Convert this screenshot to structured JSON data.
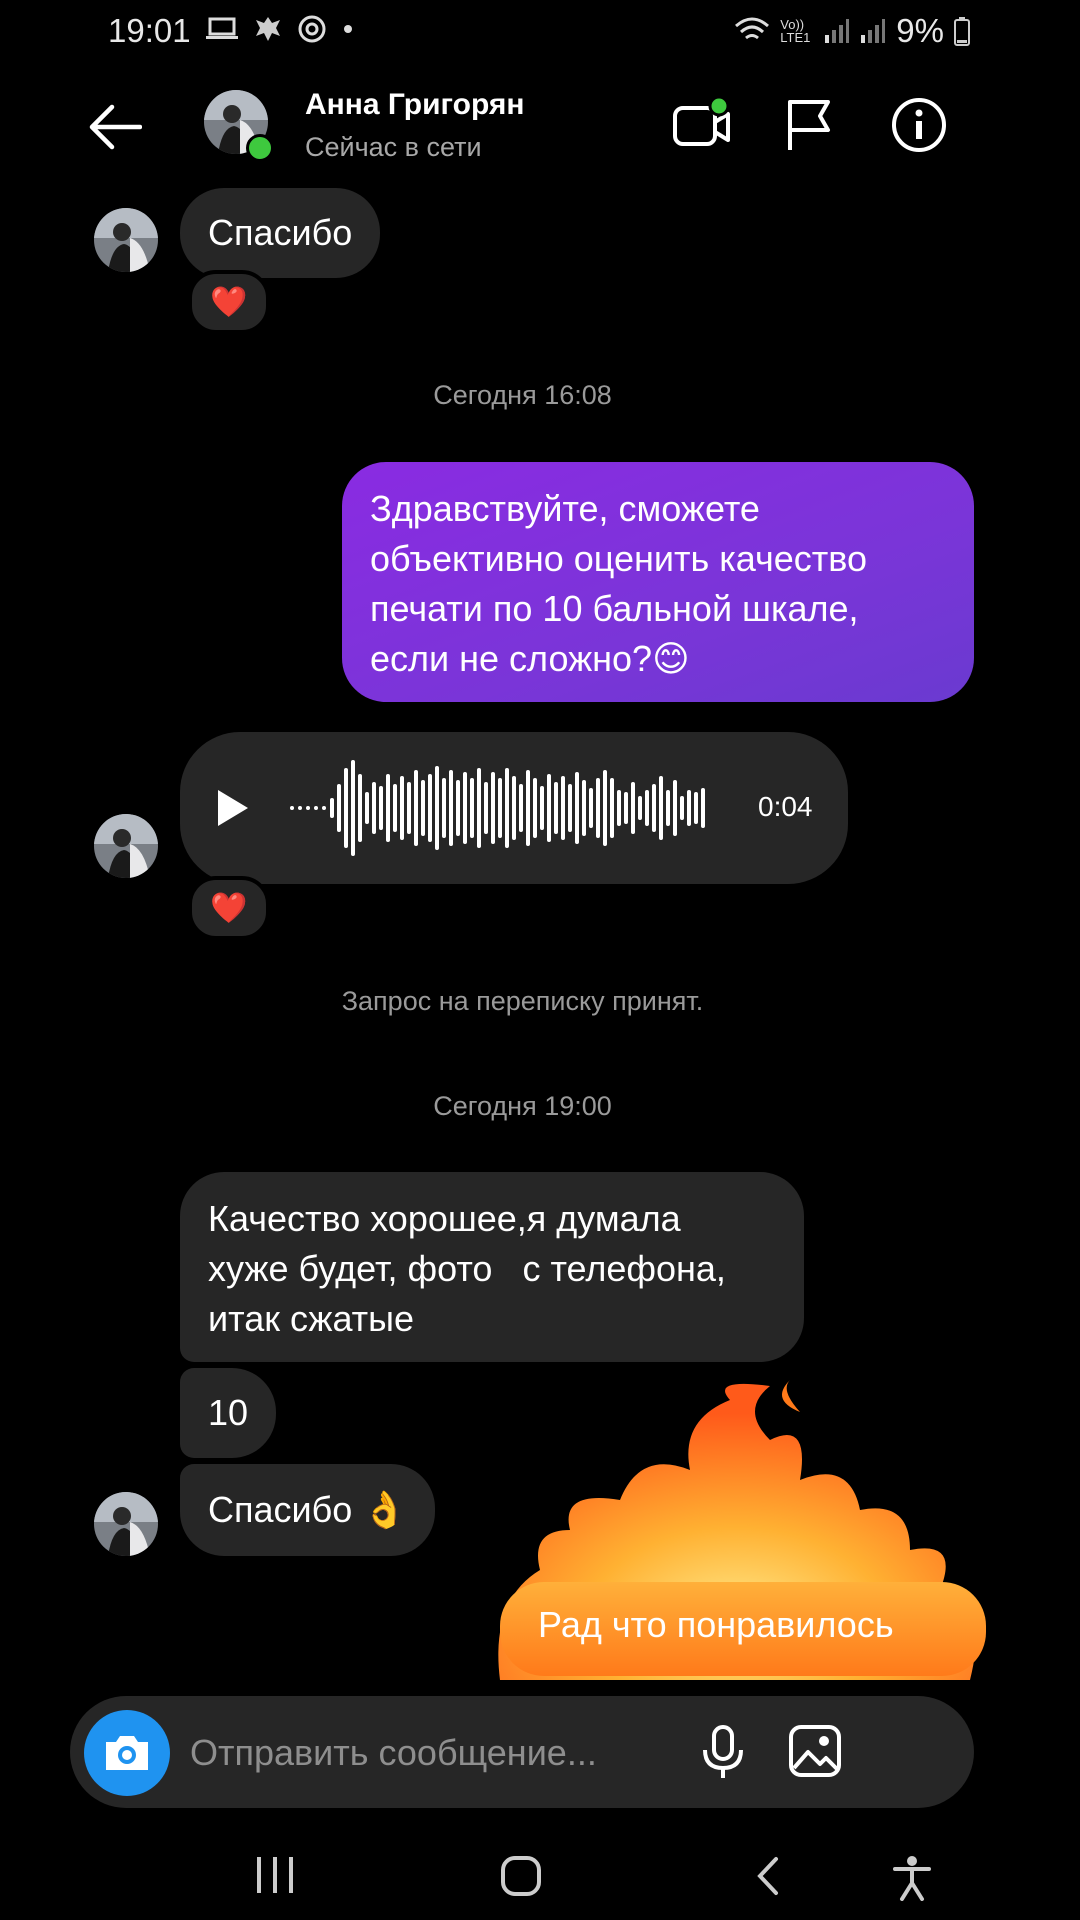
{
  "status_bar": {
    "time": "19:01",
    "lte": "Vo)) LTE1",
    "battery": "9%"
  },
  "header": {
    "name": "Анна Григорян",
    "status": "Сейчас в сети"
  },
  "messages": {
    "m1": {
      "text": "Спасибо",
      "reaction": "❤️"
    },
    "ts1": "Сегодня 16:08",
    "m2": {
      "line1": "Здравствуйте, сможете",
      "line2": "объективно оценить качество",
      "line3": "печати по 10 бальной шкале,",
      "line4": "если не сложно?😊"
    },
    "voice": {
      "duration": "0:04",
      "reaction": "❤️"
    },
    "system": "Запрос на переписку принят.",
    "ts2": "Сегодня 19:00",
    "m3": {
      "line1": "Качество хорошее,я думала",
      "line2": "хуже будет, фото   с телефона,",
      "line3": "итак сжатые"
    },
    "m4": "10",
    "m5": "Спасибо 👌",
    "m6": "Рад что понравилось"
  },
  "composer": {
    "placeholder": "Отправить сообщение..."
  },
  "colors": {
    "outgoing_bubble": "#7a35d8",
    "incoming_bubble": "#262626",
    "online": "#3ec93e",
    "camera_button": "#1f93f0"
  }
}
